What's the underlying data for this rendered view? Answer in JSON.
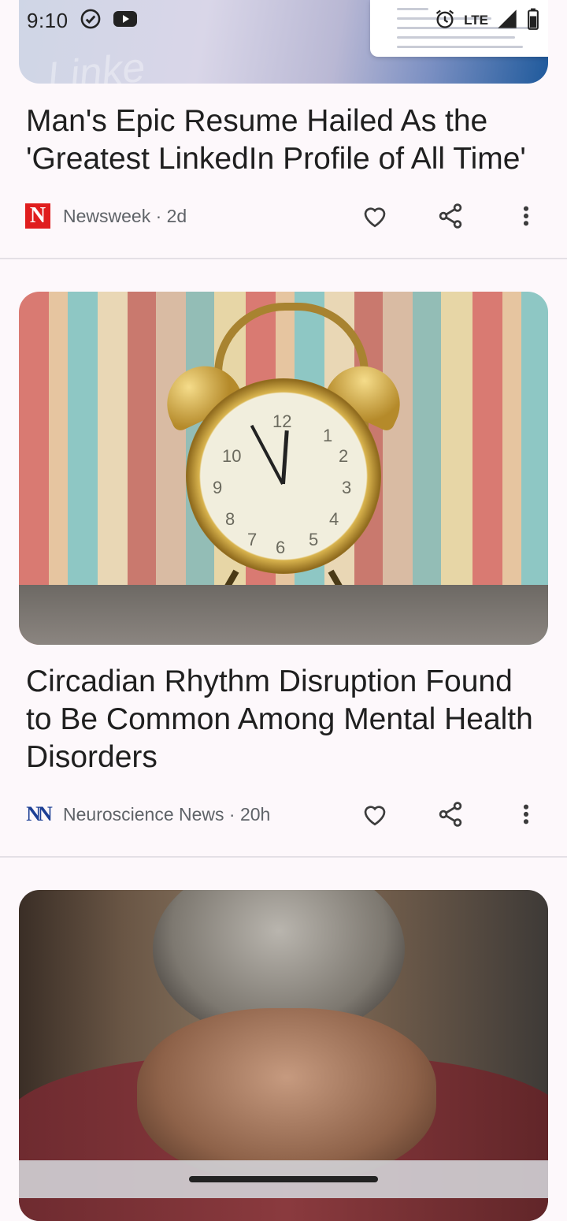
{
  "status_bar": {
    "time": "9:10",
    "network": "LTE",
    "icons": [
      "check-circle-icon",
      "youtube-icon",
      "alarm-icon",
      "signal-icon",
      "battery-icon"
    ]
  },
  "articles": [
    {
      "headline": "Man's Epic Resume Hailed As the 'Greatest LinkedIn Profile of All Time'",
      "source": "Newsweek",
      "age": "2d",
      "source_line": "Newsweek · 2d",
      "logo_letter": "N",
      "image": "resume-screenshot-image"
    },
    {
      "headline": "Circadian Rhythm Disruption Found to Be Common Among Mental Health Disorders",
      "source": "Neuroscience News",
      "age": "20h",
      "source_line": "Neuroscience News · 20h",
      "logo_letter": "N",
      "image": "alarm-clock-image"
    },
    {
      "image": "elderly-person-image"
    }
  ],
  "actions": {
    "like_icon": "heart-icon",
    "share_icon": "share-icon",
    "more_icon": "more-vert-icon"
  },
  "colors": {
    "newsweek_red": "#e01e1e",
    "background": "#fdf8fb"
  }
}
